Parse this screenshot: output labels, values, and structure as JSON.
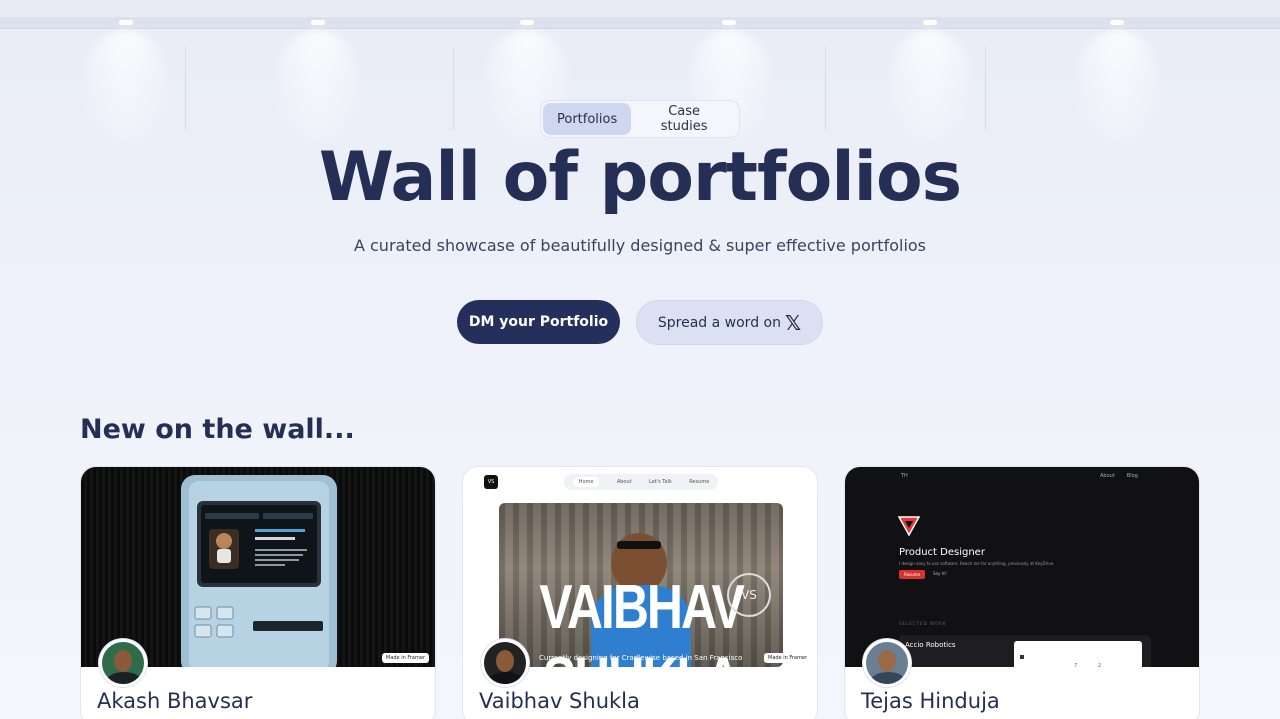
{
  "header": {
    "tabs": [
      {
        "label": "Portfolios",
        "active": true
      },
      {
        "label": "Case studies",
        "active": false
      }
    ],
    "title": "Wall of portfolios",
    "subtitle": "A curated showcase of beautifully designed & super effective portfolios",
    "cta_primary": "DM your Portfolio",
    "cta_secondary": "Spread a word on"
  },
  "section": {
    "title": "New on the wall..."
  },
  "cards": [
    {
      "name": "Akash Bhavsar",
      "screen_title": "Akash Bhavsar",
      "screen_sub": "Visual design",
      "badge": "Made in Framer"
    },
    {
      "name": "Vaibhav Shukla",
      "nav": [
        "Home",
        "About",
        "Let's Talk",
        "Resume"
      ],
      "hero_text": "VAIBHAV SHUKLA",
      "logo": "VS",
      "caption": "Currently designing for Cradlewise based in San Francisco",
      "badge": "Made in Framer"
    },
    {
      "name": "Tejas Hinduja",
      "logo": "TH",
      "role": "Product Designer",
      "desc": "I design easy to use software. Reach me for anything, previously at KeyDrive.",
      "button": "Resume",
      "link": "Say hi!",
      "section_label": "SELECTED WORK",
      "project": "Accio Robotics",
      "nav": [
        "About",
        "Blog"
      ]
    }
  ],
  "colors": {
    "primary": "#24305b",
    "secondary_bg": "#dbe0f3",
    "text": "#252f55",
    "page_bg": "#eef1f9"
  }
}
